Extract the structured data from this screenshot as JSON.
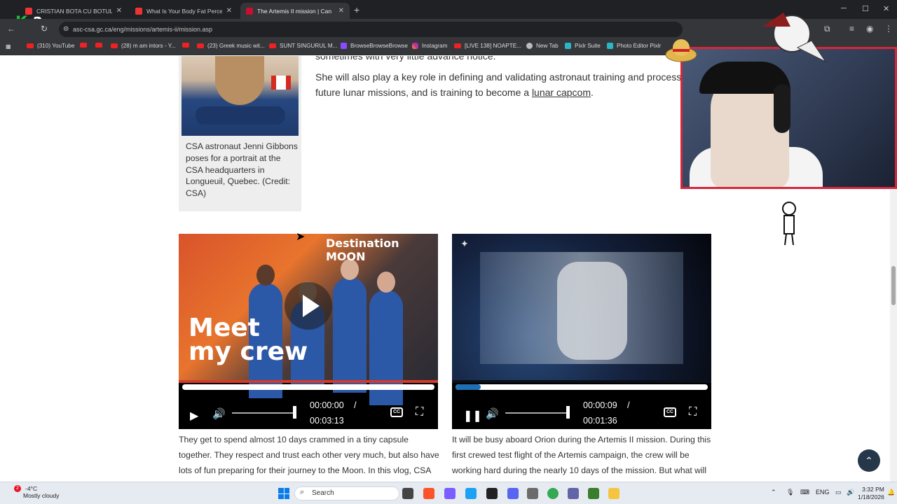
{
  "browser": {
    "tabs": [
      {
        "label": "CRISTIAN BOTA CU BOTUL PE P",
        "active": false
      },
      {
        "label": "What Is Your Body Fat Percenta",
        "active": false
      },
      {
        "label": "The Artemis II mission | Can",
        "active": true
      }
    ],
    "url": "asc-csa.gc.ca/eng/missions/artemis-ii/mission.asp",
    "bookmarks": [
      "(310) YouTube",
      "(28) m am intors - Y...",
      "(23) Greek music wit...",
      "SUNT SINGURUL M...",
      "BrowseBrowseBrowse",
      "Instagram",
      "[LIVE 138] NOAPTE...",
      "New Tab",
      "Pixlr Suite",
      "Photo Editor Pixlr"
    ]
  },
  "overlay": {
    "badge_letter": "K",
    "badge_number": "2"
  },
  "page": {
    "top_line": "sometimes with very little advance notice.",
    "para_line1": "She will also play a key role in defining and validating astronaut training and process",
    "para_line2_pre": "future lunar missions, and is training to become a ",
    "para_line2_link": "lunar capcom",
    "para_line2_post": ".",
    "caption": "CSA astronaut Jenni Gibbons poses for a portrait at the CSA headquarters in Longueuil, Quebec. (Credit: CSA)"
  },
  "videos": [
    {
      "thumb_title": "Destination MOON",
      "thumb_big_line1": "Meet",
      "thumb_big_line2": "my crew",
      "current": "00:00:00",
      "separator": "/",
      "duration": "00:03:13",
      "progress_fraction": 0.0,
      "play_state": "paused",
      "cc": "CC",
      "description": "They get to spend almost 10 days crammed in a tiny capsule together. They respect and trust each other very much, but also have lots of fun preparing for their journey to the Moon. In this vlog, CSA"
    },
    {
      "current": "00:00:09",
      "separator": "/",
      "duration": "00:01:36",
      "progress_fraction": 0.1,
      "play_state": "playing",
      "cc": "CC",
      "description": "It will be busy aboard Orion during the Artemis II mission. During this first crewed test flight of the Artemis campaign, the crew will be working hard during the nearly 10 days of the mission. But what will"
    }
  ],
  "taskbar": {
    "weather_temp": "-4°C",
    "weather_desc": "Mostly cloudy",
    "weather_badge": "2",
    "search_placeholder": "Search",
    "language": "ENG",
    "time": "3:32 PM",
    "date": "1/18/2026"
  },
  "colors": {
    "accent_blue": "#1f6fb5",
    "cam_border": "#d6263c",
    "backtop": "#26374a"
  }
}
